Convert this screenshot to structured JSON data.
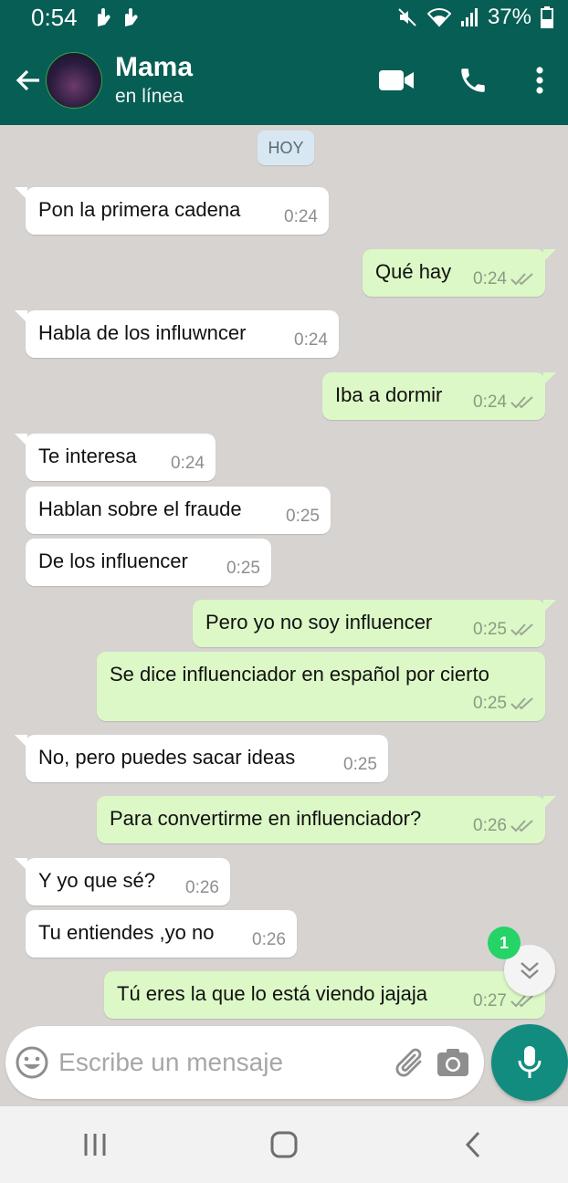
{
  "statusbar": {
    "time": "0:54",
    "battery": "37%"
  },
  "header": {
    "contact_name": "Mama",
    "contact_status": "en línea"
  },
  "chat": {
    "day_label": "HOY",
    "messages": [
      {
        "dir": "in",
        "text": "Pon la primera cadena",
        "time": "0:24"
      },
      {
        "dir": "out",
        "text": "Qué hay",
        "time": "0:24"
      },
      {
        "dir": "in",
        "text": "Habla de los influwncer",
        "time": "0:24"
      },
      {
        "dir": "out",
        "text": "Iba a dormir",
        "time": "0:24"
      },
      {
        "dir": "in",
        "text": "Te interesa",
        "time": "0:24"
      },
      {
        "dir": "in",
        "text": "Hablan sobre el fraude",
        "time": "0:25"
      },
      {
        "dir": "in",
        "text": "De los influencer",
        "time": "0:25"
      },
      {
        "dir": "out",
        "text": "Pero yo no soy influencer",
        "time": "0:25"
      },
      {
        "dir": "out",
        "text": "Se dice influenciador en español por cierto",
        "time": "0:25"
      },
      {
        "dir": "in",
        "text": "No, pero puedes sacar ideas",
        "time": "0:25"
      },
      {
        "dir": "out",
        "text": "Para convertirme en influenciador?",
        "time": "0:26"
      },
      {
        "dir": "in",
        "text": "Y yo que sé?",
        "time": "0:26"
      },
      {
        "dir": "in",
        "text": "Tu entiendes ,yo no",
        "time": "0:26"
      },
      {
        "dir": "out",
        "text": "Tú eres la que lo está viendo jajaja",
        "time": "0:27"
      }
    ],
    "unread_count": "1"
  },
  "input": {
    "placeholder": "Escribe un mensaje"
  },
  "colors": {
    "header": "#075e54",
    "outgoing": "#dcf8c6",
    "incoming": "#ffffff",
    "accent": "#128c7e",
    "badge": "#25d366"
  },
  "icons": [
    "back-arrow-icon",
    "video-call-icon",
    "phone-icon",
    "more-options-icon",
    "emoji-icon",
    "attach-icon",
    "camera-icon",
    "mic-icon",
    "scroll-down-icon",
    "recents-icon",
    "home-icon",
    "nav-back-icon"
  ]
}
